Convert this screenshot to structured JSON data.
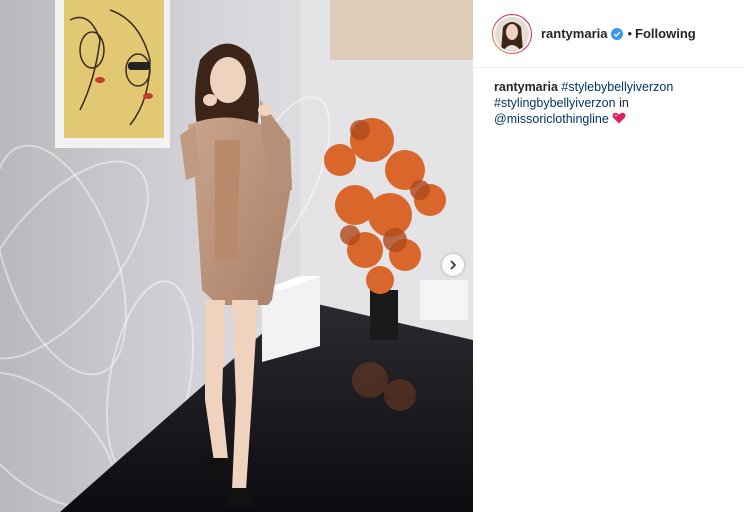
{
  "post": {
    "username": "rantymaria",
    "separator": "•",
    "follow_status": "Following"
  },
  "caption": {
    "author": "rantymaria",
    "hashtag_1": "#stylebybellyiverzon",
    "hashtag_2": "#stylingbybellyiverzon",
    "in_text": "in",
    "mention": "@missoriclothingline",
    "emoji": "red-heart-icon"
  },
  "icons": {
    "verified": "verified-badge-icon",
    "next": "chevron-right-icon"
  },
  "colors": {
    "link": "#003569",
    "verified": "#3897f0",
    "heart": "#e0245e"
  }
}
